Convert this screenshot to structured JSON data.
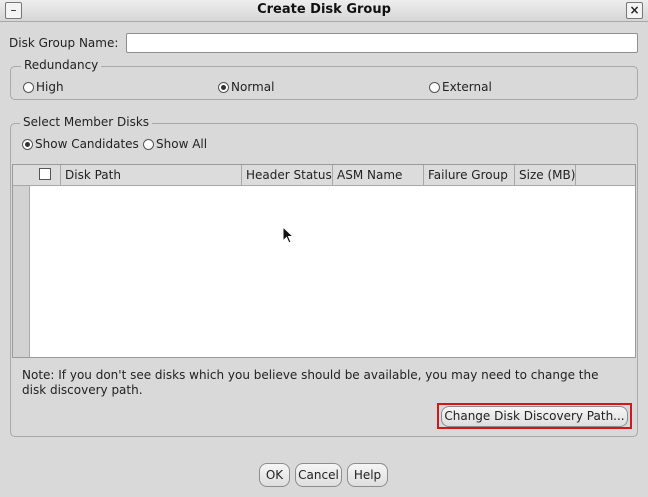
{
  "window": {
    "title": "Create Disk Group",
    "close_glyph": "×",
    "menu_glyph": "–"
  },
  "disk_group_name": {
    "label": "Disk Group Name:",
    "value": ""
  },
  "redundancy": {
    "title": "Redundancy",
    "options": [
      {
        "label": "High",
        "selected": false
      },
      {
        "label": "Normal",
        "selected": true
      },
      {
        "label": "External",
        "selected": false
      }
    ]
  },
  "member_disks": {
    "title": "Select Member Disks",
    "filter_options": [
      {
        "label": "Show Candidates",
        "selected": true
      },
      {
        "label": "Show All",
        "selected": false
      }
    ],
    "columns": [
      "Disk Path",
      "Header Status",
      "ASM Name",
      "Failure Group",
      "Size (MB)"
    ],
    "rows": [],
    "note": "Note: If you don't see disks which you believe should be available, you may need to change the disk discovery path.",
    "change_path_button": "Change Disk Discovery Path..."
  },
  "footer": {
    "ok": "OK",
    "cancel": "Cancel",
    "help": "Help"
  },
  "colors": {
    "highlight": "#d01818",
    "background": "#d9d9d9"
  }
}
